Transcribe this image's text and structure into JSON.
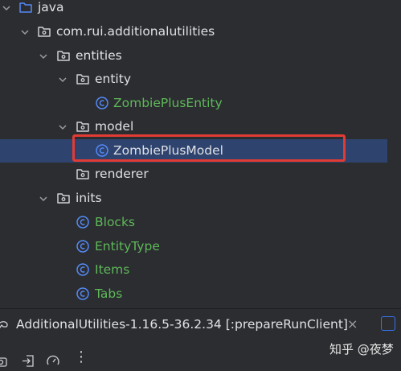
{
  "tree": {
    "java": "java",
    "package": "com.rui.additionalutilities",
    "entities": "entities",
    "entity": "entity",
    "zombie_plus_entity": "ZombiePlusEntity",
    "model": "model",
    "zombie_plus_model": "ZombiePlusModel",
    "renderer": "renderer",
    "inits": "inits",
    "blocks": "Blocks",
    "entity_type": "EntityType",
    "items": "Items",
    "tabs": "Tabs"
  },
  "run_bar": {
    "config_label": "AdditionalUtilities-1.16.5-36.2.34 [:prepareRunClient]",
    "close_glyph": "×"
  },
  "bottom_toolbar": {
    "more_glyph": "⋮"
  },
  "watermark": "知乎 @夜梦",
  "colors": {
    "background": "#2b2d30",
    "selection": "#2e436e",
    "highlight_border": "#e23b34",
    "class_icon": "#548af7",
    "class_name_green": "#5fb85a",
    "text": "#dfe1e5"
  },
  "icons": {
    "folder": "folder-icon",
    "package": "package-icon",
    "class": "class-icon",
    "chevron": "chevron-down-icon"
  }
}
